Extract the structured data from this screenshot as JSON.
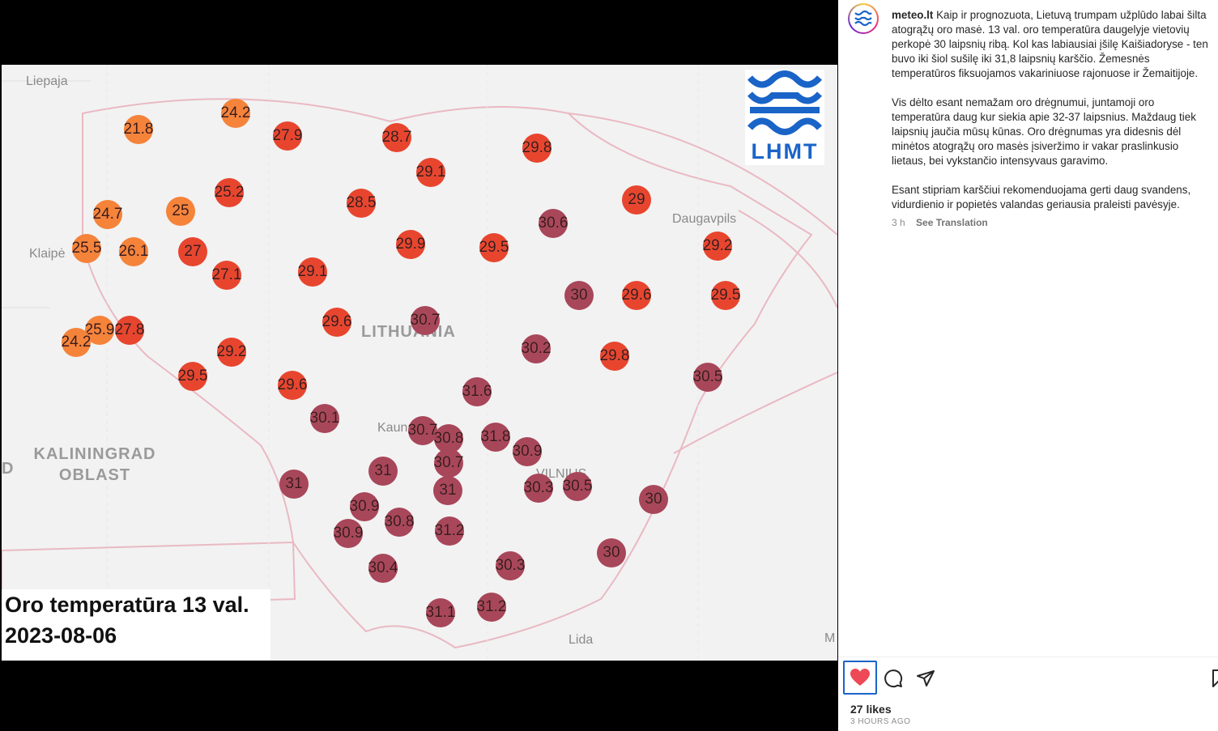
{
  "map": {
    "places": {
      "liepaja": "Liepaja",
      "klaipeda": "Klaipė",
      "daugavpils": "Daugavpils",
      "lithuania": "LITHUANIA",
      "kaliningrad_1": "KALININGRAD",
      "kaliningrad_2": "OBLAST",
      "kaunas": "Kaun",
      "vilnius": "VILNIUS",
      "lida": "Lida",
      "left_edge": "D",
      "right_edge": "M"
    },
    "logo_text": "LHMT",
    "caption_line1": "Oro temperatūra 13 val.",
    "caption_line2": "2023-08-06",
    "colors": {
      "orange": "#f5833a",
      "red": "#e8452e",
      "maroon": "#a8465a"
    },
    "stations": [
      {
        "v": "21.8",
        "c": "orange"
      },
      {
        "v": "24.2",
        "c": "orange"
      },
      {
        "v": "27.9",
        "c": "red"
      },
      {
        "v": "28.7",
        "c": "red"
      },
      {
        "v": "29.8",
        "c": "red"
      },
      {
        "v": "29.1",
        "c": "red"
      },
      {
        "v": "25.2",
        "c": "red"
      },
      {
        "v": "24.7",
        "c": "orange"
      },
      {
        "v": "25",
        "c": "orange"
      },
      {
        "v": "28.5",
        "c": "red"
      },
      {
        "v": "30.6",
        "c": "maroon"
      },
      {
        "v": "29",
        "c": "red"
      },
      {
        "v": "25.5",
        "c": "orange"
      },
      {
        "v": "26.1",
        "c": "orange"
      },
      {
        "v": "27",
        "c": "red"
      },
      {
        "v": "29.9",
        "c": "red"
      },
      {
        "v": "29.5",
        "c": "red"
      },
      {
        "v": "29.2",
        "c": "red"
      },
      {
        "v": "27.1",
        "c": "red"
      },
      {
        "v": "29.1",
        "c": "red"
      },
      {
        "v": "30",
        "c": "maroon"
      },
      {
        "v": "29.6",
        "c": "red"
      },
      {
        "v": "29.5",
        "c": "red"
      },
      {
        "v": "29.6",
        "c": "red"
      },
      {
        "v": "30.7",
        "c": "maroon"
      },
      {
        "v": "25.9",
        "c": "orange"
      },
      {
        "v": "27.8",
        "c": "red"
      },
      {
        "v": "24.2",
        "c": "orange"
      },
      {
        "v": "30.2",
        "c": "maroon"
      },
      {
        "v": "29.8",
        "c": "red"
      },
      {
        "v": "29.2",
        "c": "red"
      },
      {
        "v": "29.5",
        "c": "red"
      },
      {
        "v": "30.5",
        "c": "maroon"
      },
      {
        "v": "29.6",
        "c": "red"
      },
      {
        "v": "31.6",
        "c": "maroon"
      },
      {
        "v": "30.1",
        "c": "maroon"
      },
      {
        "v": "30.7",
        "c": "maroon"
      },
      {
        "v": "30.8",
        "c": "maroon"
      },
      {
        "v": "31.8",
        "c": "maroon"
      },
      {
        "v": "30.9",
        "c": "maroon"
      },
      {
        "v": "30.7",
        "c": "maroon"
      },
      {
        "v": "31",
        "c": "maroon"
      },
      {
        "v": "31",
        "c": "maroon"
      },
      {
        "v": "31",
        "c": "maroon"
      },
      {
        "v": "30.3",
        "c": "maroon"
      },
      {
        "v": "30.5",
        "c": "maroon"
      },
      {
        "v": "30",
        "c": "maroon"
      },
      {
        "v": "30.9",
        "c": "maroon"
      },
      {
        "v": "30.8",
        "c": "maroon"
      },
      {
        "v": "31.2",
        "c": "maroon"
      },
      {
        "v": "30.9",
        "c": "maroon"
      },
      {
        "v": "30",
        "c": "maroon"
      },
      {
        "v": "30.4",
        "c": "maroon"
      },
      {
        "v": "30.3",
        "c": "maroon"
      },
      {
        "v": "31.1",
        "c": "maroon"
      },
      {
        "v": "31.2",
        "c": "maroon"
      }
    ]
  },
  "post": {
    "username": "meteo.lt",
    "paragraph1": "Kaip ir prognozuota, Lietuvą trumpam užplūdo labai šilta atogrąžų oro masė. 13 val. oro temperatūra daugelyje vietovių perkopė 30 laipsnių ribą. Kol kas labiausiai įšilę Kaišiadoryse - ten buvo iki šiol sušilę iki 31,8 laipsnių karščio. Žemesnės temperatūros fiksuojamos vakariniuose rajonuose ir Žemaitijoje.",
    "paragraph2": "Vis dėlto esant nemažam oro drėgnumui, juntamoji oro temperatūra daug kur siekia apie 32-37 laipsnius. Maždaug tiek laipsnių jaučia mūsų kūnas. Oro drėgnumas yra didesnis dėl minėtos atogrąžų oro masės įsiveržimo ir vakar praslinkusio lietaus, bei vykstančio intensyvaus garavimo.",
    "paragraph3": "Esant stipriam karščiui rekomenduojama gerti daug svandens, vidurdienio ir popietės valandas geriausia praleisti pavėsyje.",
    "time": "3 h",
    "see_translation": "See Translation",
    "likes": "27 likes",
    "timestamp": "3 HOURS AGO",
    "heart_color": "#ed4956"
  }
}
